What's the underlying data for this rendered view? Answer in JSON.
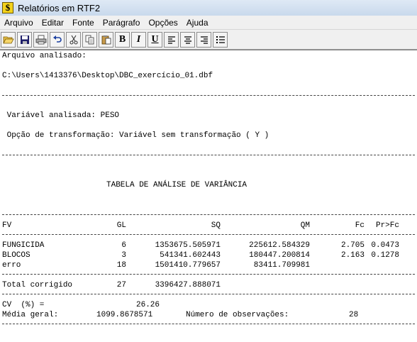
{
  "window": {
    "title": "Relatórios em RTF2",
    "icon": "dollar-icon"
  },
  "menu": [
    "Arquivo",
    "Editar",
    "Fonte",
    "Parágrafo",
    "Opções",
    "Ajuda"
  ],
  "toolbar": {
    "buttons": [
      "open-icon",
      "save-icon",
      "print-icon",
      "undo-icon",
      "cut-icon",
      "copy-icon",
      "paste-icon",
      "bold-icon",
      "italic-icon",
      "underline-icon",
      "align-left-icon",
      "align-center-icon",
      "align-right-icon",
      "bullets-icon"
    ],
    "bold_label": "B",
    "italic_label": "I",
    "underline_label": "U"
  },
  "report": {
    "file_label": "Arquivo analisado:",
    "file_path": "C:\\Users\\1413376\\Desktop\\DBC_exercício_01.dbf",
    "variable_line": " Variável analisada: PESO",
    "transform_line": " Opção de transformação: Variável sem transformação ( Y )",
    "table_title": "TABELA DE ANÁLISE DE VARIÂNCIA",
    "headers": [
      "FV",
      "GL",
      "SQ",
      "QM",
      "Fc",
      "Pr>Fc"
    ],
    "rows": [
      [
        "FUNGICIDA",
        "6",
        "1353675.505971",
        "225612.584329",
        "2.705",
        "0.0473"
      ],
      [
        "BLOCOS",
        "3",
        "541341.602443",
        "180447.200814",
        "2.163",
        "0.1278"
      ],
      [
        "erro",
        "18",
        "1501410.779657",
        "83411.709981",
        "",
        ""
      ]
    ],
    "total": [
      "Total corrigido",
      "27",
      "3396427.888071"
    ],
    "cv_label": "CV  (%) =",
    "cv_value": "26.26",
    "mean_label": "Média geral:",
    "mean_value": "1099.8678571",
    "obs_label": "Número de observações:",
    "obs_value": "28"
  }
}
